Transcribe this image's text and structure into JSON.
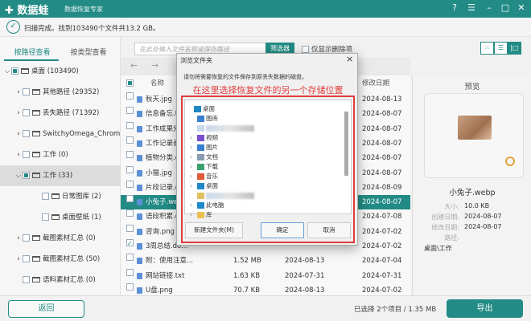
{
  "app": {
    "name": "数据蛙",
    "subtitle": "数据恢复专家"
  },
  "status": "扫描完成。找到103490个文件共13.2 GB。",
  "tabs": {
    "path": "按路径查看",
    "type": "按类型查看"
  },
  "tree": [
    {
      "label": "桌面 (103490)",
      "level": 0,
      "chev": "⌵",
      "cb": "part"
    },
    {
      "label": "其他路径 (29352)",
      "level": 1,
      "chev": "›",
      "cb": ""
    },
    {
      "label": "丢失路径 (71392)",
      "level": 1,
      "chev": "›",
      "cb": ""
    },
    {
      "label": "SwitchyOmega_Chromium",
      "level": 1,
      "chev": "›",
      "cb": ""
    },
    {
      "label": "工作 (0)",
      "level": 1,
      "chev": "›",
      "cb": ""
    },
    {
      "label": "工作 (33)",
      "level": 1,
      "chev": "⌵",
      "cb": "part",
      "selected": true
    },
    {
      "label": "日常图库 (2)",
      "level": 2,
      "chev": "",
      "cb": ""
    },
    {
      "label": "桌面壁纸 (1)",
      "level": 2,
      "chev": "",
      "cb": ""
    },
    {
      "label": "截图素材汇总 (0)",
      "level": 1,
      "chev": "›",
      "cb": ""
    },
    {
      "label": "截图素材汇总 (50)",
      "level": 1,
      "chev": "›",
      "cb": ""
    },
    {
      "label": "语料素材汇总 (0)",
      "level": 1,
      "chev": "",
      "cb": ""
    }
  ],
  "toolbar": {
    "search_placeholder": "在此处输入文件名称或保存路径",
    "filter": "筛选器",
    "deleted_only": "仅显示删除项"
  },
  "table": {
    "headers": {
      "name": "名称",
      "modified": "修改日期"
    },
    "rows": [
      {
        "name": "秋天.jpg",
        "size": "",
        "created": "",
        "modified": "2024-08-13"
      },
      {
        "name": "信息备忘.t",
        "size": "",
        "created": "",
        "modified": "2024-08-07"
      },
      {
        "name": "工作成果分",
        "size": "",
        "created": "",
        "modified": "2024-08-07"
      },
      {
        "name": "工作记录表",
        "size": "",
        "created": "",
        "modified": "2024-08-07"
      },
      {
        "name": "植物分类.d",
        "size": "",
        "created": "",
        "modified": "2024-08-07"
      },
      {
        "name": "小猫.jpg",
        "size": "",
        "created": "",
        "modified": "2024-08-07"
      },
      {
        "name": "片段记录.d",
        "size": "",
        "created": "",
        "modified": "2024-08-09"
      },
      {
        "name": "小兔子.we",
        "size": "",
        "created": "",
        "modified": "2024-08-07",
        "selected": true
      },
      {
        "name": "语段积累.d",
        "size": "",
        "created": "",
        "modified": "2024-07-08"
      },
      {
        "name": "咨询.png",
        "size": "",
        "created": "",
        "modified": "2024-07-02"
      },
      {
        "name": "3周总结.do...",
        "size": "",
        "created": "",
        "modified": "2024-07-02",
        "checked": true
      },
      {
        "name": "附：使用注意...",
        "size": "1.52 MB",
        "created": "2024-08-13",
        "modified": "2024-07-04"
      },
      {
        "name": "网站链接.txt",
        "size": "1.63 KB",
        "created": "2024-07-31",
        "modified": "2024-07-31"
      },
      {
        "name": "U盘.png",
        "size": "70.7 KB",
        "created": "2024-08-13",
        "modified": "2024-07-02"
      }
    ]
  },
  "preview": {
    "title": "预览",
    "filename": "小兔子.webp",
    "size_label": "大小:",
    "size": "10.0 KB",
    "created_label": "创建日期:",
    "created": "2024-08-07",
    "modified_label": "修改日期:",
    "modified": "2024-08-07",
    "path_label": "路径:",
    "path": "桌面\\工作"
  },
  "bottom": {
    "back": "返回",
    "selected": "已选择 2个项目 / 1.35 MB",
    "export": "导出"
  },
  "dialog": {
    "title": "浏览文件夹",
    "message": "请勿将需要恢复的文件保存到原丢失数据的磁盘。",
    "annotation": "在这里选择恢复文件的另一个存储位置",
    "new_folder": "新建文件夹(M)",
    "ok": "确定",
    "cancel": "取消",
    "items": [
      {
        "label": "桌面",
        "indent": 0,
        "chev": "",
        "color": "#1e88c8"
      },
      {
        "label": "图库",
        "indent": 1,
        "chev": "",
        "color": "#3a7fd0"
      },
      {
        "label": "",
        "indent": 1,
        "chev": "",
        "color": "#c9d8ea",
        "blur": true
      },
      {
        "label": "视频",
        "indent": 1,
        "chev": "›",
        "color": "#7a4fd0"
      },
      {
        "label": "图片",
        "indent": 1,
        "chev": "›",
        "color": "#3a7fd0"
      },
      {
        "label": "文档",
        "indent": 1,
        "chev": "›",
        "color": "#8a9ab0"
      },
      {
        "label": "下载",
        "indent": 1,
        "chev": "›",
        "color": "#3aa070"
      },
      {
        "label": "音乐",
        "indent": 1,
        "chev": "›",
        "color": "#e05a3a"
      },
      {
        "label": "桌面",
        "indent": 1,
        "chev": "›",
        "color": "#1e88c8"
      },
      {
        "label": "",
        "indent": 1,
        "chev": "",
        "color": "#e0c060",
        "blur": true
      },
      {
        "label": "此电脑",
        "indent": 1,
        "chev": "›",
        "color": "#1e88c8"
      },
      {
        "label": "库",
        "indent": 1,
        "chev": "›",
        "color": "#e8c050"
      }
    ]
  },
  "colors": {
    "accent": "#238b85",
    "annotation": "#e23c3c"
  }
}
